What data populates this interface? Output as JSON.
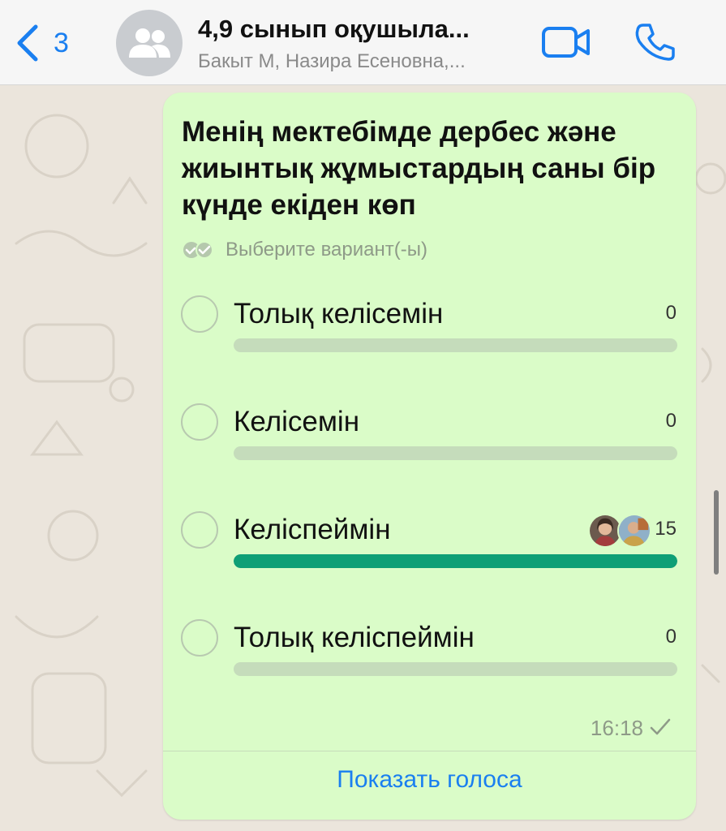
{
  "header": {
    "back_count": "3",
    "title": "4,9 сынып оқушыла...",
    "subtitle": "Бакыт М, Назира Есеновна,..."
  },
  "poll": {
    "question": "Менің мектебімде дербес және жиынтық жұмыстардың саны бір күнде екіден көп",
    "hint": "Выберите вариант(-ы)",
    "options": [
      {
        "label": "Толық келісемін",
        "count": "0",
        "fraction": 0
      },
      {
        "label": "Келісемін",
        "count": "0",
        "fraction": 0
      },
      {
        "label": "Келіспеймін",
        "count": "15",
        "fraction": 1
      },
      {
        "label": "Толық келіспеймін",
        "count": "0",
        "fraction": 0
      }
    ],
    "time": "16:18",
    "show_votes": "Показать голоса"
  },
  "colors": {
    "accent": "#1a7ff0",
    "bubble": "#dafcc8",
    "bar_fill": "#0e9f76",
    "bar_track": "#c5dcbb"
  },
  "icons": [
    "back-chevron-icon",
    "group-avatar-icon",
    "video-call-icon",
    "phone-icon",
    "double-check-icon",
    "single-check-icon"
  ]
}
